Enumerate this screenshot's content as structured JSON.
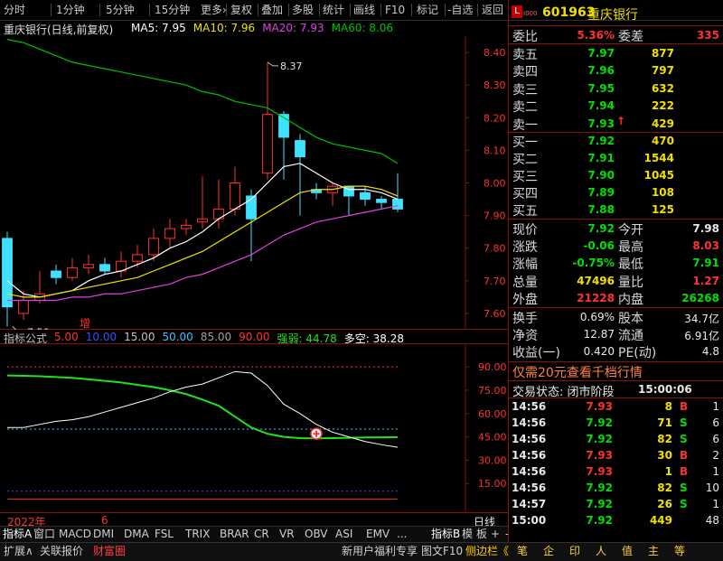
{
  "toolbar": {
    "left": [
      "分时",
      "1分钟",
      "5分钟",
      "15分钟",
      "更多›"
    ],
    "right": [
      "复权",
      "叠加",
      "多股",
      "统计",
      "画线",
      "F10",
      "标记",
      "-自选",
      "返回"
    ]
  },
  "stock": {
    "badge": "L",
    "level": "I000",
    "code": "601963",
    "name": "重庆银行"
  },
  "chart_title": "重庆银行(日线,前复权)",
  "ma_legend": [
    {
      "label": "MA5: 7.95",
      "color": "#ffffff"
    },
    {
      "label": "MA10: 7.96",
      "color": "#f0e000"
    },
    {
      "label": "MA20: 7.93",
      "color": "#e040e0"
    },
    {
      "label": "MA60: 8.06",
      "color": "#00c000"
    }
  ],
  "indicator_legend": [
    {
      "label": "指标公式",
      "color": "#c0c0c0"
    },
    {
      "label": "5.00",
      "color": "#ff3232"
    },
    {
      "label": "10.00",
      "color": "#3050ff"
    },
    {
      "label": "15.00",
      "color": "#c0c0c0"
    },
    {
      "label": "50.00",
      "color": "#40c0ff"
    },
    {
      "label": "85.00",
      "color": "#a0a0a0"
    },
    {
      "label": "90.00",
      "color": "#ff3232"
    },
    {
      "label": "强弱: 44.78",
      "color": "#20e020"
    },
    {
      "label": "多空: 38.28",
      "color": "#ffffff"
    }
  ],
  "annotations": {
    "high": "8.37",
    "low": "7.56",
    "zeng": "增",
    "year": "2022年",
    "month": "6",
    "period": "日线"
  },
  "chart_data": [
    {
      "type": "candlestick",
      "title": "重庆银行(日线,前复权)",
      "ylim": [
        7.55,
        8.45
      ],
      "yticks": [
        7.6,
        7.7,
        7.8,
        7.9,
        8.0,
        8.1,
        8.2,
        8.3,
        8.4
      ],
      "x": [
        1,
        2,
        3,
        4,
        5,
        6,
        7,
        8,
        9,
        10,
        11,
        12,
        13,
        14,
        15,
        16,
        17,
        18,
        19,
        20,
        21,
        22,
        23,
        24,
        25
      ],
      "open": [
        7.83,
        7.6,
        7.64,
        7.73,
        7.71,
        7.74,
        7.75,
        7.73,
        7.76,
        7.78,
        7.83,
        7.86,
        7.88,
        7.89,
        7.92,
        7.96,
        8.03,
        8.21,
        8.13,
        7.98,
        7.97,
        7.99,
        7.97,
        7.95,
        7.95
      ],
      "close": [
        7.62,
        7.64,
        7.66,
        7.71,
        7.74,
        7.75,
        7.73,
        7.76,
        7.78,
        7.83,
        7.86,
        7.87,
        7.89,
        7.92,
        8.0,
        7.89,
        8.21,
        8.14,
        8.08,
        7.97,
        7.99,
        7.96,
        7.95,
        7.94,
        7.92
      ],
      "high": [
        7.85,
        7.67,
        7.73,
        7.75,
        7.77,
        7.78,
        7.77,
        7.79,
        7.81,
        7.86,
        7.89,
        7.89,
        8.02,
        8.01,
        8.05,
        7.98,
        8.37,
        8.22,
        8.15,
        8.0,
        8.0,
        7.99,
        7.99,
        7.96,
        8.03
      ],
      "low": [
        7.56,
        7.58,
        7.63,
        7.69,
        7.7,
        7.72,
        7.72,
        7.71,
        7.74,
        7.76,
        7.8,
        7.84,
        7.86,
        7.86,
        7.9,
        7.76,
        8.01,
        8.01,
        7.9,
        7.95,
        7.93,
        7.9,
        7.93,
        7.92,
        7.91
      ],
      "series": [
        {
          "name": "MA5",
          "color": "#ffffff",
          "values": [
            7.7,
            7.66,
            7.65,
            7.66,
            7.67,
            7.7,
            7.72,
            7.73,
            7.75,
            7.77,
            7.8,
            7.82,
            7.85,
            7.89,
            7.92,
            7.95,
            8.0,
            8.05,
            8.06,
            8.03,
            8.0,
            7.98,
            7.98,
            7.97,
            7.95
          ]
        },
        {
          "name": "MA10",
          "color": "#f0e000",
          "values": [
            7.66,
            7.65,
            7.65,
            7.66,
            7.67,
            7.68,
            7.69,
            7.7,
            7.71,
            7.73,
            7.75,
            7.77,
            7.79,
            7.82,
            7.85,
            7.88,
            7.91,
            7.94,
            7.97,
            7.98,
            7.98,
            7.99,
            7.99,
            7.98,
            7.96
          ]
        },
        {
          "name": "MA20",
          "color": "#e040e0",
          "values": [
            7.64,
            7.64,
            7.64,
            7.64,
            7.65,
            7.65,
            7.66,
            7.66,
            7.67,
            7.68,
            7.69,
            7.71,
            7.72,
            7.74,
            7.76,
            7.78,
            7.81,
            7.84,
            7.86,
            7.88,
            7.89,
            7.9,
            7.91,
            7.92,
            7.93
          ]
        },
        {
          "name": "MA60",
          "color": "#00c000",
          "values": [
            8.44,
            8.43,
            8.41,
            8.39,
            8.37,
            8.36,
            8.35,
            8.34,
            8.33,
            8.32,
            8.31,
            8.3,
            8.28,
            8.27,
            8.25,
            8.24,
            8.23,
            8.2,
            8.17,
            8.14,
            8.12,
            8.11,
            8.1,
            8.09,
            8.06
          ]
        }
      ]
    },
    {
      "type": "line",
      "ylim": [
        0,
        100
      ],
      "yticks": [
        15,
        30,
        45,
        60,
        75,
        90
      ],
      "x": [
        1,
        2,
        3,
        4,
        5,
        6,
        7,
        8,
        9,
        10,
        11,
        12,
        13,
        14,
        15,
        16,
        17,
        18,
        19,
        20,
        21,
        22,
        23,
        24,
        25
      ],
      "hlines": [
        {
          "value": 90,
          "color": "#ff3232",
          "style": "dashed"
        },
        {
          "value": 50,
          "color": "#40c0ff",
          "style": "dashed"
        },
        {
          "value": 10,
          "color": "#3050ff",
          "style": "dashed"
        },
        {
          "value": 5,
          "color": "#ff3232",
          "style": "solid"
        }
      ],
      "series": [
        {
          "name": "强弱",
          "color": "#20e020",
          "values": [
            84.5,
            84.3,
            84,
            83.5,
            83,
            82,
            81,
            80,
            78.5,
            77,
            75,
            72.5,
            69,
            65,
            58,
            51,
            47,
            45,
            44.2,
            44,
            44.2,
            44.4,
            44.6,
            44.7,
            44.8
          ]
        },
        {
          "name": "多空",
          "color": "#ffffff",
          "values": [
            51,
            51,
            53,
            55,
            56,
            58,
            61,
            64,
            67,
            70,
            74,
            77,
            79,
            83,
            87,
            86,
            78,
            66,
            60,
            53,
            48,
            45,
            42,
            40,
            38.3
          ]
        }
      ],
      "marker": {
        "x": 20,
        "y": 47
      }
    }
  ],
  "quote": {
    "weibi_label": "委比",
    "weibi": "5.36%",
    "weicha_label": "委差",
    "weicha": "335",
    "asks": [
      {
        "label": "卖五",
        "price": "7.97",
        "vol": "877"
      },
      {
        "label": "卖四",
        "price": "7.96",
        "vol": "797"
      },
      {
        "label": "卖三",
        "price": "7.95",
        "vol": "632"
      },
      {
        "label": "卖二",
        "price": "7.94",
        "vol": "222"
      },
      {
        "label": "卖一",
        "price": "7.93",
        "vol": "429"
      }
    ],
    "bids": [
      {
        "label": "买一",
        "price": "7.92",
        "vol": "470"
      },
      {
        "label": "买二",
        "price": "7.91",
        "vol": "1544"
      },
      {
        "label": "买三",
        "price": "7.90",
        "vol": "1045"
      },
      {
        "label": "买四",
        "price": "7.89",
        "vol": "108"
      },
      {
        "label": "买五",
        "price": "7.88",
        "vol": "125"
      }
    ],
    "stats": [
      {
        "l1": "现价",
        "v1": "7.92",
        "c1": "grn",
        "l2": "今开",
        "v2": "7.98",
        "c2": "wht"
      },
      {
        "l1": "涨跌",
        "v1": "-0.06",
        "c1": "grn",
        "l2": "最高",
        "v2": "8.03",
        "c2": "red"
      },
      {
        "l1": "涨幅",
        "v1": "-0.75%",
        "c1": "grn",
        "l2": "最低",
        "v2": "7.91",
        "c2": "grn"
      },
      {
        "l1": "总量",
        "v1": "47496",
        "c1": "yel",
        "l2": "量比",
        "v2": "1.27",
        "c2": "red"
      },
      {
        "l1": "外盘",
        "v1": "21228",
        "c1": "red",
        "l2": "内盘",
        "v2": "26268",
        "c2": "grn"
      }
    ],
    "stats2": [
      {
        "l1": "换手",
        "v1": "0.69%",
        "l2": "股本",
        "v2": "34.7亿"
      },
      {
        "l1": "净资",
        "v1": "12.87",
        "l2": "流通",
        "v2": "6.91亿"
      },
      {
        "l1": "收益(一)",
        "v1": "0.420",
        "l2": "PE(动)",
        "v2": "4.8"
      }
    ],
    "promo": "仅需20元查看千档行情",
    "trade_status_label": "交易状态: 闭市阶段",
    "trade_time": "15:00:06",
    "ticks": [
      {
        "t": "14:56",
        "p": "7.93",
        "v": "8",
        "s": "B",
        "n": "1"
      },
      {
        "t": "14:56",
        "p": "7.92",
        "v": "71",
        "s": "S",
        "n": "6"
      },
      {
        "t": "14:56",
        "p": "7.92",
        "v": "82",
        "s": "S",
        "n": "6"
      },
      {
        "t": "14:56",
        "p": "7.93",
        "v": "30",
        "s": "B",
        "n": "2"
      },
      {
        "t": "14:56",
        "p": "7.93",
        "v": "1",
        "s": "B",
        "n": "1"
      },
      {
        "t": "14:56",
        "p": "7.92",
        "v": "82",
        "s": "S",
        "n": "10"
      },
      {
        "t": "14:57",
        "p": "7.92",
        "v": "26",
        "s": "S",
        "n": "1"
      },
      {
        "t": "15:00",
        "p": "7.92",
        "v": "449",
        "s": "",
        "n": "48"
      }
    ]
  },
  "bottom_tabs": [
    "指标A",
    "窗口",
    "MACD",
    "DMI",
    "DMA",
    "FSL",
    "TRIX",
    "BRAR",
    "CR",
    "VR",
    "OBV",
    "ASI",
    "EMV",
    "...",
    "指标B",
    "模",
    "板",
    "+",
    "-"
  ],
  "bottom_bar": {
    "left": [
      "扩展∧",
      "关联报价",
      "财富圈"
    ],
    "right": [
      "新用户福利专享",
      "图文F10",
      "侧边栏《"
    ],
    "icons": [
      "笔",
      "企",
      "印",
      "人",
      "值",
      "主",
      "等"
    ]
  }
}
